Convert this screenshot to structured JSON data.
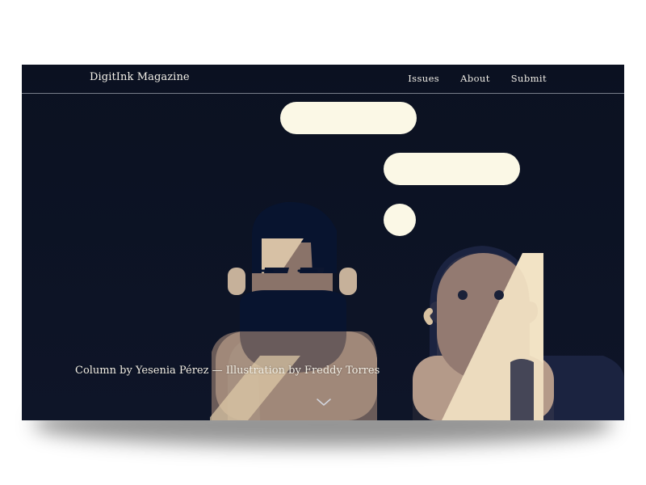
{
  "header": {
    "brand": "DigitInk Magazine",
    "nav": [
      {
        "label": "Issues"
      },
      {
        "label": "About"
      },
      {
        "label": "Submit"
      }
    ]
  },
  "hero": {
    "caption": "Column by Yesenia Pérez — Illustration by Freddy Torres",
    "scroll_icon": "chevron-down-icon"
  },
  "colors": {
    "background": "#0b1121",
    "bubble": "#fbf8e6",
    "skin": "#cdb79d",
    "skin_shadow": "#7f6a67",
    "hair": "#08142f",
    "text": "#f2eee4"
  }
}
